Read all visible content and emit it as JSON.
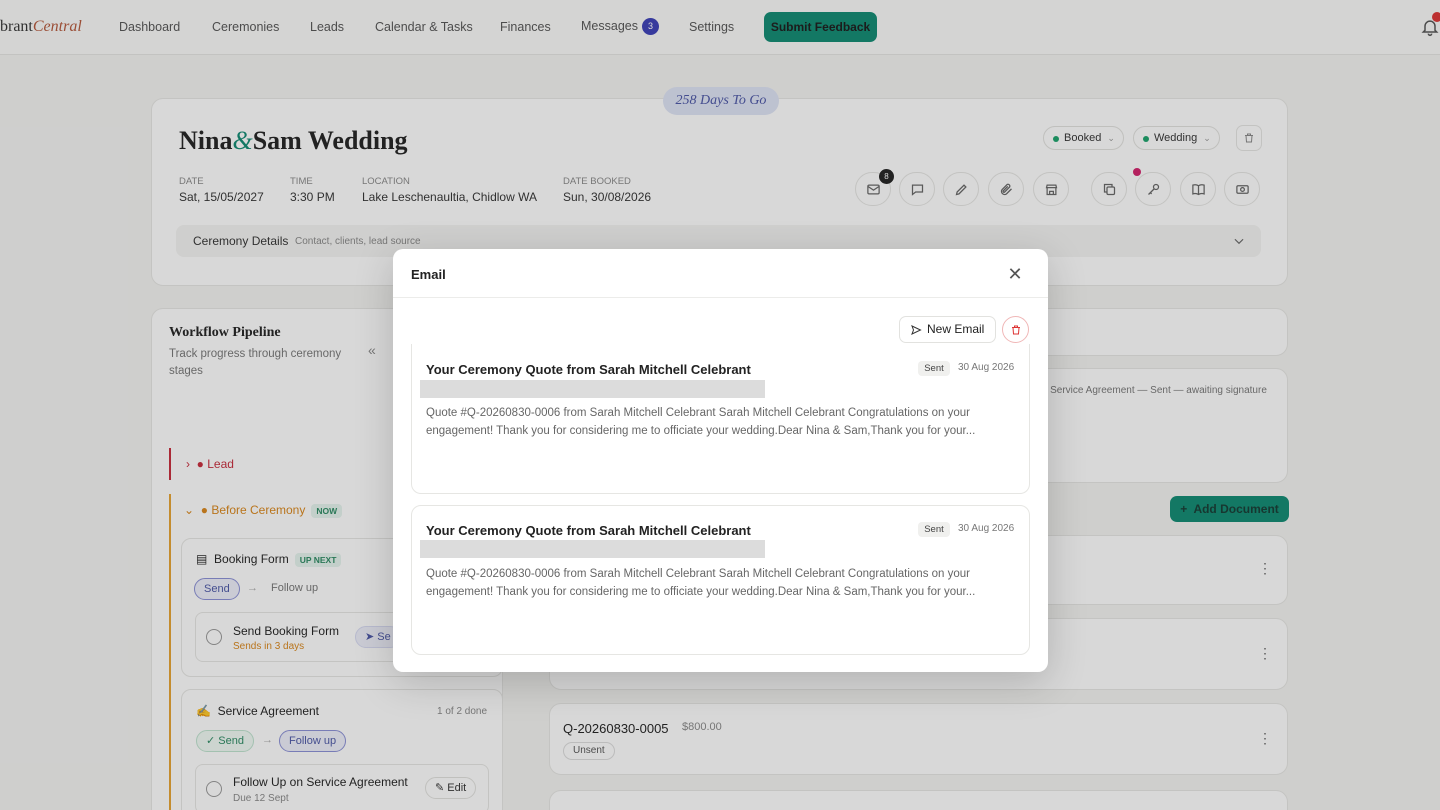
{
  "nav": {
    "logo_prefix": "brant",
    "logo_suffix": "Central",
    "items": [
      "Dashboard",
      "Ceremonies",
      "Leads",
      "Calendar & Tasks",
      "Finances",
      "Messages",
      "Settings"
    ],
    "messages_badge": "3",
    "feedback_label": "Submit Feedback"
  },
  "ceremony": {
    "countdown": "258 Days To Go",
    "name_a": "Nina",
    "amp": "&",
    "name_b": "Sam Wedding",
    "status_pill": "Booked",
    "type_pill": "Wedding",
    "date_label": "DATE",
    "date_value": "Sat, 15/05/2027",
    "time_label": "TIME",
    "time_value": "3:30 PM",
    "location_label": "LOCATION",
    "location_value": "Lake Leschenaultia, Chidlow WA",
    "booked_label": "DATE BOOKED",
    "booked_value": "Sun, 30/08/2026",
    "email_count": "8",
    "details_title": "Ceremony Details",
    "details_sub": "Contact, clients, lead source"
  },
  "workflow": {
    "title": "Workflow Pipeline",
    "subtitle": "Track progress through ceremony stages",
    "lead_label": "Lead",
    "before_label": "Before Ceremony",
    "before_tag": "NOW",
    "booking_form": "Booking Form",
    "booking_tag": "UP NEXT",
    "send": "Send",
    "follow_up": "Follow up",
    "send_booking_form": "Send Booking Form",
    "sends_in": "Sends in 3 days",
    "send_short": "Se",
    "service_agreement": "Service Agreement",
    "sa_progress": "1 of 2 done",
    "sa_send": "Send",
    "sa_follow_up": "Follow up",
    "follow_up_sa": "Follow Up on Service Agreement",
    "due": "Due 12 Sept",
    "edit": "Edit"
  },
  "documents": {
    "status_text": "r Service Agreement — Sent — awaiting signature",
    "add_document": "Add Document",
    "quote_id": "Q-20260830-0005",
    "quote_amount": "$800.00",
    "quote_status": "Unsent"
  },
  "modal": {
    "title": "Email",
    "new_email": "New Email",
    "emails": [
      {
        "subject": "Your Ceremony Quote from Sarah Mitchell Celebrant",
        "status": "Sent",
        "date": "30 Aug 2026",
        "preview": "Quote #Q-20260830-0006 from Sarah Mitchell Celebrant Sarah Mitchell Celebrant Congratulations on your engagement! Thank you for considering me to officiate your wedding.Dear Nina & Sam,Thank you for your..."
      },
      {
        "subject": "Your Ceremony Quote from Sarah Mitchell Celebrant",
        "status": "Sent",
        "date": "30 Aug 2026",
        "preview": "Quote #Q-20260830-0006 from Sarah Mitchell Celebrant Sarah Mitchell Celebrant Congratulations on your engagement! Thank you for considering me to officiate your wedding.Dear Nina & Sam,Thank you for your..."
      }
    ]
  }
}
